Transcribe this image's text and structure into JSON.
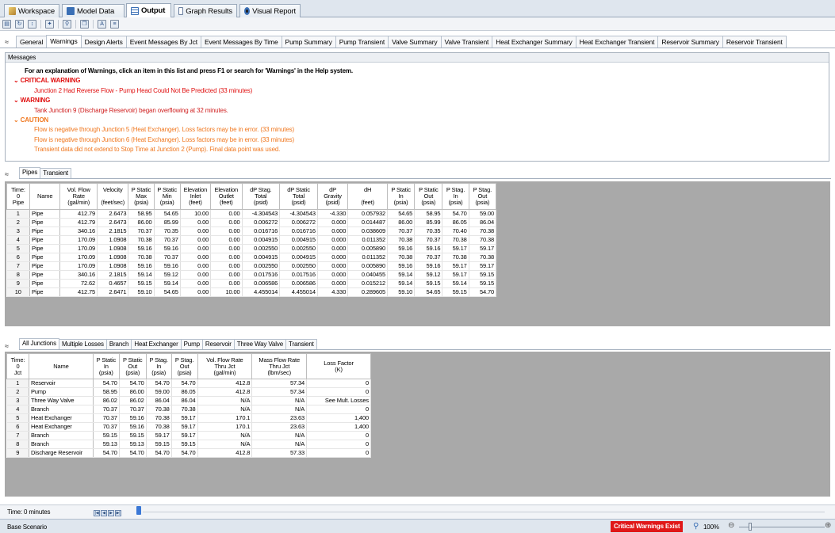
{
  "top_tabs": [
    {
      "label": "Workspace",
      "icon": "workspace-icon",
      "color": "#c8a040"
    },
    {
      "label": "Model Data",
      "icon": "model-data-icon",
      "color": "#3a6fb5"
    },
    {
      "label": "Output",
      "icon": "output-icon",
      "color": "#3a6fb5"
    },
    {
      "label": "Graph Results",
      "icon": "graph-icon",
      "color": "#6a7fa0"
    },
    {
      "label": "Visual Report",
      "icon": "visual-report-icon",
      "color": "#3a6fb5"
    }
  ],
  "output_tabs": [
    "General",
    "Warnings",
    "Design Alerts",
    "Event Messages By Jct",
    "Event Messages By Time",
    "Pump Summary",
    "Pump Transient",
    "Valve Summary",
    "Valve Transient",
    "Heat Exchanger Summary",
    "Heat Exchanger Transient",
    "Reservoir Summary",
    "Reservoir Transient"
  ],
  "messages": {
    "header": "Messages",
    "intro": "For an explanation of Warnings, click an item in this list and press F1 or search for 'Warnings' in the Help system.",
    "critical_title": "CRITICAL WARNING",
    "critical_items": [
      "Junction 2 Had Reverse Flow - Pump Head Could Not Be Predicted (33 minutes)"
    ],
    "warning_title": "WARNING",
    "warning_items": [
      "Tank Junction 9 (Discharge Reservoir) began overflowing at 32 minutes."
    ],
    "caution_title": "CAUTION",
    "caution_items": [
      "Flow is negative through Junction 5 (Heat Exchanger). Loss factors may be in error. (33 minutes)",
      "Flow is negative through Junction 6 (Heat Exchanger). Loss factors may be in error. (33 minutes)",
      "Transient data did not extend to Stop Time at Junction 2 (Pump). Final data point was used."
    ],
    "colors": {
      "critical": "#e01010",
      "caution": "#f07820"
    }
  },
  "pipe_tabs": [
    "Pipes",
    "Transient"
  ],
  "pipes": {
    "headers": [
      "Time:\n0\nPipe",
      "Name",
      "Vol. Flow\nRate\n(gal/min)",
      "Velocity\n\n(feet/sec)",
      "P Static\nMax\n(psia)",
      "P Static\nMin\n(psia)",
      "Elevation\nInlet\n(feet)",
      "Elevation\nOutlet\n(feet)",
      "dP Stag.\nTotal\n(psid)",
      "dP Static\nTotal\n(psid)",
      "dP\nGravity\n(psid)",
      "dH\n\n(feet)",
      "P Static\nIn\n(psia)",
      "P Static\nOut\n(psia)",
      "P Stag.\nIn\n(psia)",
      "P Stag.\nOut\n(psia)"
    ],
    "rows": [
      [
        "1",
        "Pipe",
        "412.79",
        "2.6473",
        "58.95",
        "54.65",
        "10.00",
        "0.00",
        "-4.304543",
        "-4.304543",
        "-4.330",
        "0.057932",
        "54.65",
        "58.95",
        "54.70",
        "59.00"
      ],
      [
        "2",
        "Pipe",
        "412.79",
        "2.6473",
        "86.00",
        "85.99",
        "0.00",
        "0.00",
        "0.006272",
        "0.006272",
        "0.000",
        "0.014487",
        "86.00",
        "85.99",
        "86.05",
        "86.04"
      ],
      [
        "3",
        "Pipe",
        "340.16",
        "2.1815",
        "70.37",
        "70.35",
        "0.00",
        "0.00",
        "0.016716",
        "0.016716",
        "0.000",
        "0.038609",
        "70.37",
        "70.35",
        "70.40",
        "70.38"
      ],
      [
        "4",
        "Pipe",
        "170.09",
        "1.0908",
        "70.38",
        "70.37",
        "0.00",
        "0.00",
        "0.004915",
        "0.004915",
        "0.000",
        "0.011352",
        "70.38",
        "70.37",
        "70.38",
        "70.38"
      ],
      [
        "5",
        "Pipe",
        "170.09",
        "1.0908",
        "59.16",
        "59.16",
        "0.00",
        "0.00",
        "0.002550",
        "0.002550",
        "0.000",
        "0.005890",
        "59.16",
        "59.16",
        "59.17",
        "59.17"
      ],
      [
        "6",
        "Pipe",
        "170.09",
        "1.0908",
        "70.38",
        "70.37",
        "0.00",
        "0.00",
        "0.004915",
        "0.004915",
        "0.000",
        "0.011352",
        "70.38",
        "70.37",
        "70.38",
        "70.38"
      ],
      [
        "7",
        "Pipe",
        "170.09",
        "1.0908",
        "59.16",
        "59.16",
        "0.00",
        "0.00",
        "0.002550",
        "0.002550",
        "0.000",
        "0.005890",
        "59.16",
        "59.16",
        "59.17",
        "59.17"
      ],
      [
        "8",
        "Pipe",
        "340.16",
        "2.1815",
        "59.14",
        "59.12",
        "0.00",
        "0.00",
        "0.017516",
        "0.017516",
        "0.000",
        "0.040455",
        "59.14",
        "59.12",
        "59.17",
        "59.15"
      ],
      [
        "9",
        "Pipe",
        "72.62",
        "0.4657",
        "59.15",
        "59.14",
        "0.00",
        "0.00",
        "0.006586",
        "0.006586",
        "0.000",
        "0.015212",
        "59.14",
        "59.15",
        "59.14",
        "59.15"
      ],
      [
        "10",
        "Pipe",
        "412.75",
        "2.6471",
        "59.10",
        "54.65",
        "0.00",
        "10.00",
        "4.455014",
        "4.455014",
        "4.330",
        "0.289605",
        "59.10",
        "54.65",
        "59.15",
        "54.70"
      ]
    ]
  },
  "junction_tabs": [
    "All Junctions",
    "Multiple Losses",
    "Branch",
    "Heat Exchanger",
    "Pump",
    "Reservoir",
    "Three Way Valve",
    "Transient"
  ],
  "junctions": {
    "headers": [
      "Time:\n0\nJct",
      "Name",
      "P Static\nIn\n(psia)",
      "P Static\nOut\n(psia)",
      "P Stag.\nIn\n(psia)",
      "P Stag.\nOut\n(psia)",
      "Vol. Flow Rate\nThru Jct\n(gal/min)",
      "Mass Flow Rate\nThru Jct\n(lbm/sec)",
      "Loss Factor\n(K)"
    ],
    "rows": [
      [
        "1",
        "Reservoir",
        "54.70",
        "54.70",
        "54.70",
        "54.70",
        "412.8",
        "57.34",
        "0"
      ],
      [
        "2",
        "Pump",
        "58.95",
        "86.00",
        "59.00",
        "86.05",
        "412.8",
        "57.34",
        "0"
      ],
      [
        "3",
        "Three Way Valve",
        "86.02",
        "86.02",
        "86.04",
        "86.04",
        "N/A",
        "N/A",
        "See Mult. Losses"
      ],
      [
        "4",
        "Branch",
        "70.37",
        "70.37",
        "70.38",
        "70.38",
        "N/A",
        "N/A",
        "0"
      ],
      [
        "5",
        "Heat Exchanger",
        "70.37",
        "59.16",
        "70.38",
        "59.17",
        "170.1",
        "23.63",
        "1,400"
      ],
      [
        "6",
        "Heat Exchanger",
        "70.37",
        "59.16",
        "70.38",
        "59.17",
        "170.1",
        "23.63",
        "1,400"
      ],
      [
        "7",
        "Branch",
        "59.15",
        "59.15",
        "59.17",
        "59.17",
        "N/A",
        "N/A",
        "0"
      ],
      [
        "8",
        "Branch",
        "59.13",
        "59.13",
        "59.15",
        "59.15",
        "N/A",
        "N/A",
        "0"
      ],
      [
        "9",
        "Discharge Reservoir",
        "54.70",
        "54.70",
        "54.70",
        "54.70",
        "412.8",
        "57.33",
        "0"
      ]
    ]
  },
  "time_bar": {
    "label": "Time: 0 minutes"
  },
  "status_bar": {
    "scenario": "Base Scenario",
    "critical_badge": "Critical Warnings Exist",
    "zoom": "100%",
    "badge_color": "#e01818"
  }
}
